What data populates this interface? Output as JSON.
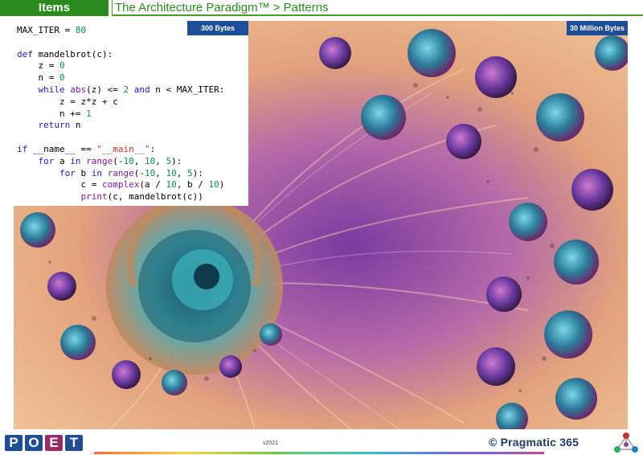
{
  "header": {
    "section": "Items",
    "title": "The Architecture Paradigm™ > Patterns"
  },
  "code_panel": {
    "badge": "300 Bytes",
    "lines": [
      "MAX_ITER = 80",
      "",
      "def mandelbrot(c):",
      "    z = 0",
      "    n = 0",
      "    while abs(z) <= 2 and n < MAX_ITER:",
      "        z = z*z + c",
      "        n += 1",
      "    return n",
      "",
      "if __name__ == \"__main__\":",
      "    for a in range(-10, 10, 5):",
      "        for b in range(-10, 10, 5):",
      "            c = complex(a / 10, b / 10)",
      "            print(c, mandelbrot(c))"
    ]
  },
  "image_panel": {
    "badge": "30 Million Bytes",
    "icon": "fractal-image"
  },
  "footer": {
    "logo_letters": [
      "P",
      "O",
      "E",
      "T"
    ],
    "version": "v2021",
    "brand": "© Pragmatic 365",
    "icon": "molecule-icon"
  },
  "colors": {
    "header_green": "#2a8a1e",
    "badge_blue": "#1f4e98",
    "poet_blue": "#1f4e98",
    "poet_e": "#9a2a6a"
  }
}
